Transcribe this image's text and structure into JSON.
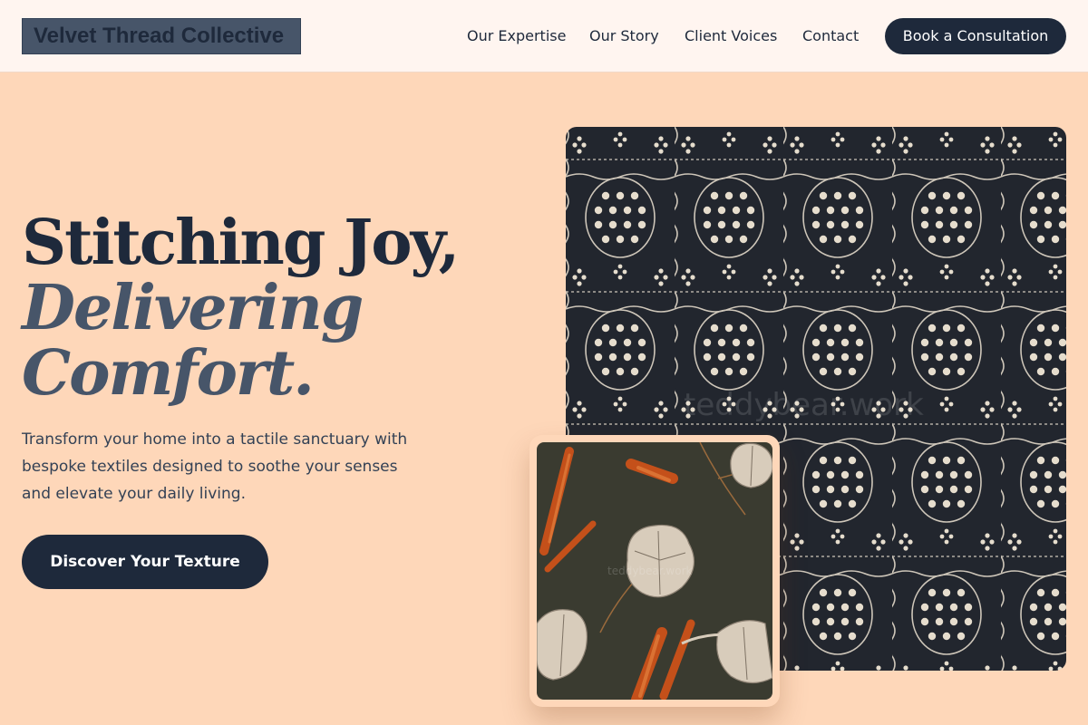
{
  "header": {
    "logo_text": "Velvet Thread Collective",
    "nav": [
      {
        "label": "Our Expertise"
      },
      {
        "label": "Our Story"
      },
      {
        "label": "Client Voices"
      },
      {
        "label": "Contact"
      }
    ],
    "cta_label": "Book a Consultation"
  },
  "hero": {
    "title_line1": "Stitching Joy,",
    "title_line2": "Delivering",
    "title_line3": "Comfort.",
    "description": "Transform your home into a tactile sanctuary with bespoke textiles designed to soothe your senses and elevate your daily living.",
    "button_label": "Discover Your Texture"
  },
  "images": {
    "pattern_watermark": "teddybear.work",
    "leaf_watermark": "teddybear.work"
  },
  "colors": {
    "page_background": "#fed7b9",
    "header_background": "#fff5f0",
    "primary_dark": "#1e293b",
    "accent_slate": "#475569"
  }
}
